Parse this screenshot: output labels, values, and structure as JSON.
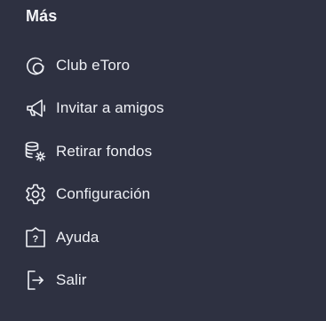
{
  "menu": {
    "title": "Más",
    "items": [
      {
        "label": "Club eToro",
        "icon": "club-icon"
      },
      {
        "label": "Invitar a amigos",
        "icon": "megaphone-icon"
      },
      {
        "label": "Retirar fondos",
        "icon": "coins-gear-icon"
      },
      {
        "label": "Configuración",
        "icon": "gear-icon"
      },
      {
        "label": "Ayuda",
        "icon": "help-icon"
      },
      {
        "label": "Salir",
        "icon": "logout-icon"
      }
    ]
  },
  "colors": {
    "background": "#2e3141",
    "text": "#eef0f5"
  }
}
